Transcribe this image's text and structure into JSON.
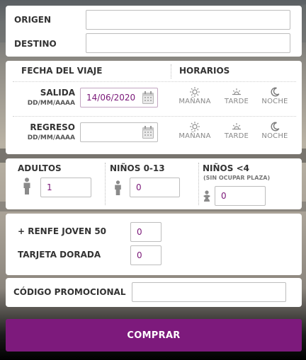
{
  "route": {
    "origin_label": "ORIGEN",
    "origin_value": "",
    "destination_label": "DESTINO",
    "destination_value": ""
  },
  "trip": {
    "date_header": "FECHA DEL VIAJE",
    "schedule_header": "HORARIOS",
    "date_format": "DD/MM/AAAA",
    "departure": {
      "label": "SALIDA",
      "value": "14/06/2020",
      "slots": [
        "MAÑANA",
        "TARDE",
        "NOCHE"
      ]
    },
    "return": {
      "label": "REGRESO",
      "value": "",
      "slots": [
        "MAÑANA",
        "TARDE",
        "NOCHE"
      ]
    }
  },
  "passengers": {
    "adults_label": "ADULTOS",
    "adults_value": "1",
    "children_label": "NIÑOS 0-13",
    "children_value": "0",
    "infants_label": "NIÑOS <4",
    "infants_note": "(SIN OCUPAR PLAZA)",
    "infants_value": "0"
  },
  "discounts": {
    "renfe_joven_label": "+ RENFE JOVEN 50",
    "renfe_joven_value": "0",
    "tarjeta_dorada_label": "TARJETA DORADA",
    "tarjeta_dorada_value": "0"
  },
  "promo": {
    "label": "CÓDIGO PROMOCIONAL",
    "value": ""
  },
  "actions": {
    "buy_label": "COMPRAR"
  },
  "colors": {
    "accent": "#7d1a7c",
    "input_text": "#7a1778",
    "icon_gray": "#8a8a8a"
  }
}
